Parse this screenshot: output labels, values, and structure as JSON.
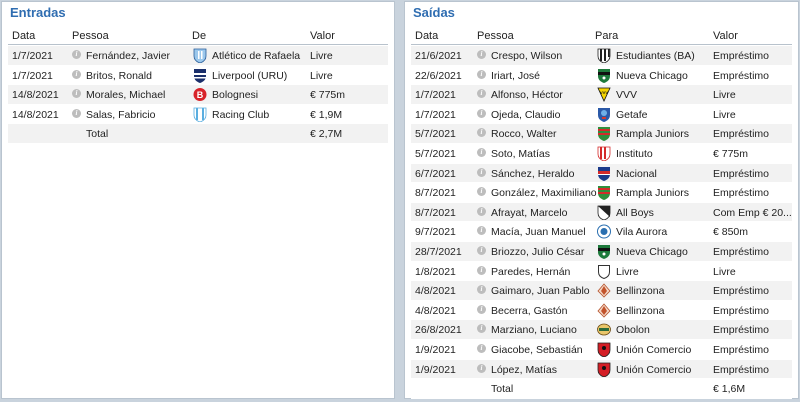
{
  "entradas": {
    "title": "Entradas",
    "headers": {
      "date": "Data",
      "person": "Pessoa",
      "from": "De",
      "value": "Valor"
    },
    "rows": [
      {
        "date": "1/7/2021",
        "person": "Fernández, Javier",
        "club": "Atlético de Rafaela",
        "value": "Livre",
        "crest": "rafaela-crest"
      },
      {
        "date": "1/7/2021",
        "person": "Britos, Ronald",
        "club": "Liverpool (URU)",
        "value": "Livre",
        "crest": "liverpool-uru-crest"
      },
      {
        "date": "14/8/2021",
        "person": "Morales, Michael",
        "club": "Bolognesi",
        "value": "€ 775m",
        "crest": "bolognesi-crest"
      },
      {
        "date": "14/8/2021",
        "person": "Salas, Fabricio",
        "club": "Racing Club",
        "value": "€ 1,9M",
        "crest": "racing-club-crest"
      }
    ],
    "total_label": "Total",
    "total_value": "€ 2,7M"
  },
  "saidas": {
    "title": "Saídas",
    "headers": {
      "date": "Data",
      "person": "Pessoa",
      "to": "Para",
      "value": "Valor"
    },
    "rows": [
      {
        "date": "21/6/2021",
        "person": "Crespo, Wilson",
        "club": "Estudiantes (BA)",
        "value": "Empréstimo",
        "crest": "estudiantes-ba-crest"
      },
      {
        "date": "22/6/2021",
        "person": "Iriart, José",
        "club": "Nueva Chicago",
        "value": "Empréstimo",
        "crest": "nueva-chicago-crest"
      },
      {
        "date": "1/7/2021",
        "person": "Alfonso, Héctor",
        "club": "VVV",
        "value": "Livre",
        "crest": "vvv-crest"
      },
      {
        "date": "1/7/2021",
        "person": "Ojeda, Claudio",
        "club": "Getafe",
        "value": "Livre",
        "crest": "getafe-crest"
      },
      {
        "date": "5/7/2021",
        "person": "Rocco, Walter",
        "club": "Rampla Juniors",
        "value": "Empréstimo",
        "crest": "rampla-juniors-crest"
      },
      {
        "date": "5/7/2021",
        "person": "Soto, Matías",
        "club": "Instituto",
        "value": "€ 775m",
        "crest": "instituto-crest"
      },
      {
        "date": "6/7/2021",
        "person": "Sánchez, Heraldo",
        "club": "Nacional",
        "value": "Empréstimo",
        "crest": "nacional-crest"
      },
      {
        "date": "8/7/2021",
        "person": "González, Maximiliano",
        "club": "Rampla Juniors",
        "value": "Empréstimo",
        "crest": "rampla-juniors-crest"
      },
      {
        "date": "8/7/2021",
        "person": "Afrayat, Marcelo",
        "club": "All Boys",
        "value": "Com Emp € 20...",
        "crest": "all-boys-crest"
      },
      {
        "date": "9/7/2021",
        "person": "Macía, Juan Manuel",
        "club": "Vila Aurora",
        "value": "€ 850m",
        "crest": "vila-aurora-crest"
      },
      {
        "date": "28/7/2021",
        "person": "Briozzo, Julio César",
        "club": "Nueva Chicago",
        "value": "Empréstimo",
        "crest": "nueva-chicago-crest"
      },
      {
        "date": "1/8/2021",
        "person": "Paredes, Hernán",
        "club": "Livre",
        "value": "Livre",
        "crest": "shield-outline-crest"
      },
      {
        "date": "4/8/2021",
        "person": "Gaimaro, Juan Pablo",
        "club": "Bellinzona",
        "value": "Empréstimo",
        "crest": "bellinzona-crest"
      },
      {
        "date": "4/8/2021",
        "person": "Becerra, Gastón",
        "club": "Bellinzona",
        "value": "Empréstimo",
        "crest": "bellinzona-crest"
      },
      {
        "date": "26/8/2021",
        "person": "Marziano, Luciano",
        "club": "Obolon",
        "value": "Empréstimo",
        "crest": "obolon-crest"
      },
      {
        "date": "1/9/2021",
        "person": "Giacobe, Sebastián",
        "club": "Unión Comercio",
        "value": "Empréstimo",
        "crest": "union-comercio-crest"
      },
      {
        "date": "1/9/2021",
        "person": "López, Matías",
        "club": "Unión Comercio",
        "value": "Empréstimo",
        "crest": "union-comercio-crest"
      }
    ],
    "total_label": "Total",
    "total_value": "€ 1,6M"
  },
  "colors": {
    "title": "#2f6db1",
    "row_alt": "#f2f2f2",
    "info_icon": "#bdbdbd"
  }
}
